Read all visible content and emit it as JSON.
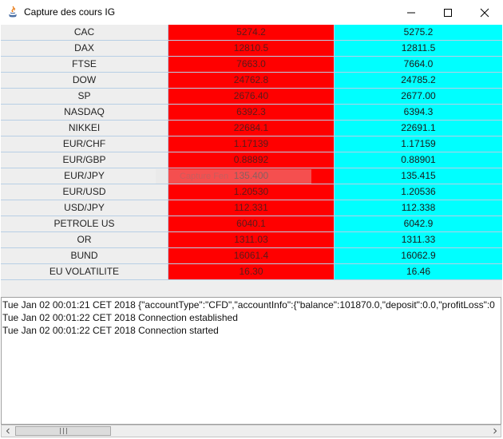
{
  "window": {
    "title": "Capture des cours IG",
    "icon": "java-icon"
  },
  "quotes": [
    {
      "name": "CAC",
      "bid": "5274.2",
      "ask": "5275.2"
    },
    {
      "name": "DAX",
      "bid": "12810.5",
      "ask": "12811.5"
    },
    {
      "name": "FTSE",
      "bid": "7663.0",
      "ask": "7664.0"
    },
    {
      "name": "DOW",
      "bid": "24762.8",
      "ask": "24785.2"
    },
    {
      "name": "SP",
      "bid": "2676.40",
      "ask": "2677.00"
    },
    {
      "name": "NASDAQ",
      "bid": "6392.3",
      "ask": "6394.3"
    },
    {
      "name": "NIKKEI",
      "bid": "22684.1",
      "ask": "22691.1"
    },
    {
      "name": "EUR/CHF",
      "bid": "1.17139",
      "ask": "1.17159"
    },
    {
      "name": "EUR/GBP",
      "bid": "0.88892",
      "ask": "0.88901"
    },
    {
      "name": "EUR/JPY",
      "bid": "135.400",
      "ask": "135.415"
    },
    {
      "name": "EUR/USD",
      "bid": "1.20530",
      "ask": "1.20536"
    },
    {
      "name": "USD/JPY",
      "bid": "112.331",
      "ask": "112.338"
    },
    {
      "name": "PETROLE US",
      "bid": "6040.1",
      "ask": "6042.9"
    },
    {
      "name": "OR",
      "bid": "1311.03",
      "ask": "1311.33"
    },
    {
      "name": "BUND",
      "bid": "16061.4",
      "ask": "16062.9"
    },
    {
      "name": "EU VOLATILITE",
      "bid": "16.30",
      "ask": "16.46"
    }
  ],
  "overlay_text": "Capture Fen",
  "log": [
    "Tue Jan 02 00:01:21 CET 2018 {\"accountType\":\"CFD\",\"accountInfo\":{\"balance\":101870.0,\"deposit\":0.0,\"profitLoss\":0",
    "Tue Jan 02 00:01:22 CET 2018 Connection established",
    "Tue Jan 02 00:01:22 CET 2018 Connection started"
  ],
  "colors": {
    "bid": "#ff0000",
    "ask": "#00ffff",
    "name_bg": "#eeeeee"
  }
}
